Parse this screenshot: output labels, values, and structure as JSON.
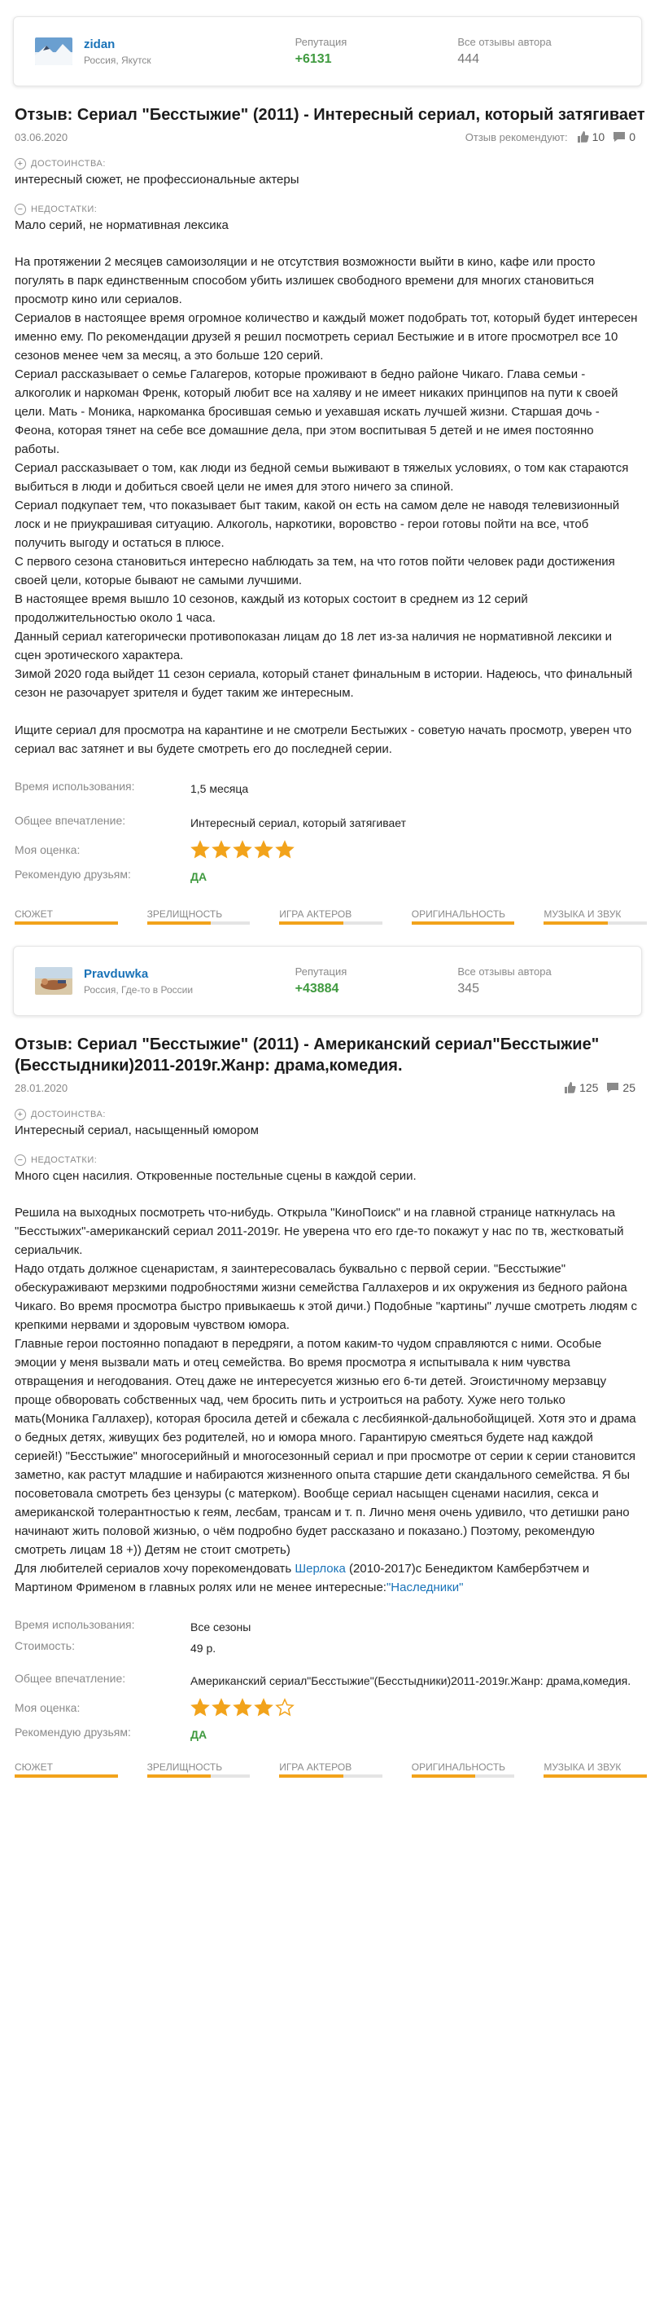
{
  "reviews": [
    {
      "author": {
        "name": "zidan",
        "location": "Россия, Якутск",
        "reputation_label": "Репутация",
        "reputation": "+6131",
        "reviews_label": "Все отзывы автора",
        "reviews_count": "444"
      },
      "title": "Отзыв: Сериал \"Бесстыжие\" (2011) - Интересный сериал, который затягивает",
      "date": "03.06.2020",
      "recommend_label": "Отзыв рекомендуют:",
      "likes": "10",
      "comments": "0",
      "pros_label": "ДОСТОИНСТВА:",
      "pros": "интересный сюжет, не профессиональные актеры",
      "cons_label": "НЕДОСТАТКИ:",
      "cons": "Мало серий, не нормативная лексика",
      "body": [
        "На протяжении 2 месяцев самоизоляции и не отсутствия возможности выйти в кино, кафе или просто погулять в парк единственным способом убить излишек свободного времени для многих становиться просмотр кино или сериалов.",
        "Сериалов в настоящее время огромное количество и каждый может подобрать тот, который будет интересен именно ему. По рекомендации друзей я решил посмотреть сериал Бестыжие и в итоге просмотрел все 10 сезонов менее чем за месяц, а это больше 120 серий.",
        "Сериал рассказывает о семье Галагеров, которые проживают в бедно районе Чикаго. Глава семьи - алкоголик и наркоман Френк, который любит все на халяву и не имеет никаких принципов на пути к своей цели. Мать - Моника, наркоманка бросившая семью и уехавшая искать лучшей жизни. Старшая дочь - Феона, которая тянет на себе все домашние дела, при этом воспитывая 5 детей и не имея постоянно работы.",
        "Сериал рассказывает о том, как люди из бедной семьи выживают в тяжелых условиях, о том как стараются выбиться в люди и добиться своей цели не имея для этого ничего за спиной.",
        "Сериал подкупает тем, что показывает быт таким, какой он есть на самом деле не наводя телевизионный лоск и не приукрашивая ситуацию. Алкоголь, наркотики, воровство - герои готовы пойти на все, чтоб получить выгоду и остаться в плюсе.",
        "С первого сезона становиться интересно наблюдать за тем, на что готов пойти человек ради достижения своей цели, которые бывают не самыми лучшими.",
        "В настоящее время вышло 10 сезонов, каждый из которых состоит в среднем из 12 серий продолжительностью около 1 часа.",
        "Данный сериал категорически противопоказан лицам до 18 лет из-за наличия не нормативной лексики и сцен эротического характера.",
        "Зимой 2020 года выйдет 11 сезон сериала, который станет финальным в истории. Надеюсь, что финальный сезон не разочарует зрителя и будет таким же интересным.",
        "Ищите сериал для просмотра на карантине и не смотрели Бестыжих - советую начать просмотр, уверен что сериал вас затянет и вы будете смотреть его до последней серии."
      ],
      "usage_label": "Время использования:",
      "usage": "1,5 месяца",
      "impression_label": "Общее впечатление:",
      "impression": "Интересный сериал, который затягивает",
      "rating_label": "Моя оценка:",
      "rating": 5,
      "recommend_friends_label": "Рекомендую друзьям:",
      "recommend_friends": "ДА",
      "categories": [
        {
          "label": "СЮЖЕТ",
          "score": 1.0
        },
        {
          "label": "ЗРЕЛИЩНОСТЬ",
          "score": 0.62
        },
        {
          "label": "ИГРА АКТЕРОВ",
          "score": 0.62
        },
        {
          "label": "ОРИГИНАЛЬНОСТЬ",
          "score": 1.0
        },
        {
          "label": "МУЗЫКА И ЗВУК",
          "score": 0.62
        }
      ]
    },
    {
      "author": {
        "name": "Pravduwka",
        "location": "Россия, Где-то в России",
        "reputation_label": "Репутация",
        "reputation": "+43884",
        "reviews_label": "Все отзывы автора",
        "reviews_count": "345"
      },
      "title": "Отзыв: Сериал \"Бесстыжие\" (2011) - Американский сериал\"Бесстыжие\"(Бесстыдники)2011-2019г.Жанр: драма,комедия.",
      "date": "28.01.2020",
      "likes": "125",
      "comments": "25",
      "pros_label": "ДОСТОИНСТВА:",
      "pros": "Интересный сериал, насыщенный юмором",
      "cons_label": "НЕДОСТАТКИ:",
      "cons": "Много сцен насилия. Откровенные постельные сцены в каждой серии.",
      "body": [
        "Решила на выходных посмотреть что-нибудь. Открыла \"КиноПоиск\" и на главной странице наткнулась на \"Бесстыжих\"-американский сериал 2011-2019г. Не уверена что его где-то покажут у нас по тв, жестковатый сериальчик.",
        "Надо отдать должное сценаристам, я заинтересовалась буквально с первой серии. \"Бесстыжие\" обескураживают мерзкими подробностями жизни семейства Галлахеров и их окружения из бедного района Чикаго. Во время просмотра быстро привыкаешь к этой дичи.) Подобные \"картины\" лучше смотреть людям с крепкими нервами и здоровым чувством юмора.",
        "Главные герои постоянно попадают в передряги, а потом каким-то чудом справляются с ними. Особые эмоции у меня вызвали мать и отец семейства. Во время просмотра я испытывала к ним чувства отвращения и негодования. Отец даже не интересуется жизнью его 6-ти детей. Эгоистичному мерзавцу проще обворовать собственных чад, чем бросить пить и устроиться на работу. Хуже него только мать(Моника Галлахер), которая бросила детей и сбежала с лесбиянкой-дальнобойщицей. Хотя это и драма о бедных детях, живущих без родителей, но и юмора много. Гарантирую смеяться будете над каждой серией!) \"Бесстыжие\" многосерийный и многосезонный сериал и при просмотре от серии к серии становится заметно, как растут младшие и набираются жизненного опыта старшие дети скандального семейства. Я бы посоветовала смотреть без цензуры (с матерком). Вообще сериал насыщен сценами насилия, секса и американской толерантностью к геям, лесбам, трансам и т. п. Лично меня очень удивило, что детишки рано начинают жить половой жизнью, о чём подробно будет рассказано и показано.) Поэтому, рекомендую смотреть лицам 18 +)) Детям не стоит смотреть)",
        "Для любителей сериалов хочу порекомендовать ",
        "Шерлока",
        " (2010-2017)с Бенедиктом Камбербэтчем и Мартином Фрименом в главных ролях или не менее интересные:",
        "\"Наследники\""
      ],
      "usage_label": "Время использования:",
      "usage": "Все сезоны",
      "cost_label": "Стоимость:",
      "cost": "49 р.",
      "impression_label": "Общее впечатление:",
      "impression": "Американский сериал\"Бесстыжие\"(Бесстыдники)2011-2019г.Жанр: драма,комедия.",
      "rating_label": "Моя оценка:",
      "rating": 4,
      "recommend_friends_label": "Рекомендую друзьям:",
      "recommend_friends": "ДА",
      "categories": [
        {
          "label": "СЮЖЕТ",
          "score": 1.0
        },
        {
          "label": "ЗРЕЛИЩНОСТЬ",
          "score": 0.62
        },
        {
          "label": "ИГРА АКТЕРОВ",
          "score": 0.62
        },
        {
          "label": "ОРИГИНАЛЬНОСТЬ",
          "score": 0.62
        },
        {
          "label": "МУЗЫКА И ЗВУК",
          "score": 1.0
        }
      ]
    }
  ],
  "colors": {
    "accent": "#f2a31b",
    "link": "#1a73b8",
    "positive": "#3f9a3f",
    "muted": "#8a8a8a"
  }
}
